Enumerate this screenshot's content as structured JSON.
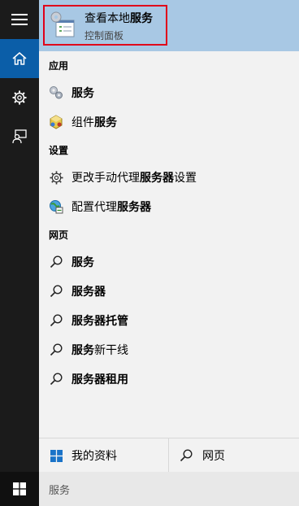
{
  "rail": {
    "items": [
      {
        "icon": "hamburger-menu-icon",
        "active": false
      },
      {
        "icon": "home-icon",
        "active": true
      },
      {
        "icon": "gear-icon",
        "active": false
      },
      {
        "icon": "feedback-person-icon",
        "active": false
      }
    ]
  },
  "top_result": {
    "title_prefix": "查看本地",
    "title_match": "服务",
    "subtitle": "控制面板",
    "icon": "services-console-icon"
  },
  "sections": [
    {
      "label": "应用",
      "items": [
        {
          "prefix": "",
          "match": "服务",
          "suffix": "",
          "icon": "services-gears-icon"
        },
        {
          "prefix": "组件",
          "match": "服务",
          "suffix": "",
          "icon": "component-services-icon"
        }
      ]
    },
    {
      "label": "设置",
      "items": [
        {
          "prefix": "更改手动代理",
          "match": "服务器",
          "suffix": "设置",
          "icon": "gear-icon"
        },
        {
          "prefix": "配置代理",
          "match": "服务器",
          "suffix": "",
          "icon": "proxy-globe-icon"
        }
      ]
    },
    {
      "label": "网页",
      "items": [
        {
          "prefix": "",
          "match": "服务",
          "suffix": "",
          "icon": "search-icon"
        },
        {
          "prefix": "",
          "match": "服务器",
          "suffix": "",
          "icon": "search-icon"
        },
        {
          "prefix": "",
          "match": "服务器托管",
          "suffix": "",
          "icon": "search-icon"
        },
        {
          "prefix": "",
          "match": "服务",
          "suffix": "新干线",
          "icon": "search-icon"
        },
        {
          "prefix": "",
          "match": "服务器租用",
          "suffix": "",
          "icon": "search-icon"
        }
      ]
    }
  ],
  "bottom": {
    "my_stuff_label": "我的资料",
    "web_label": "网页"
  },
  "search": {
    "value": "服务"
  },
  "colors": {
    "accent": "#0b5ea8",
    "top_result_bg": "#a8c8e4",
    "highlight_border": "#e0001a",
    "panel_bg": "#f2f2f2"
  }
}
